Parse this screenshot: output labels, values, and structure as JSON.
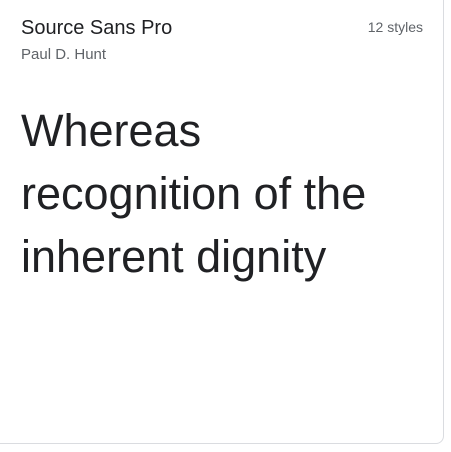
{
  "card": {
    "family_name": "Source Sans Pro",
    "designer": "Paul D. Hunt",
    "styles_count": "12 styles",
    "preview_text": "Whereas recognition of the inherent dignity"
  }
}
